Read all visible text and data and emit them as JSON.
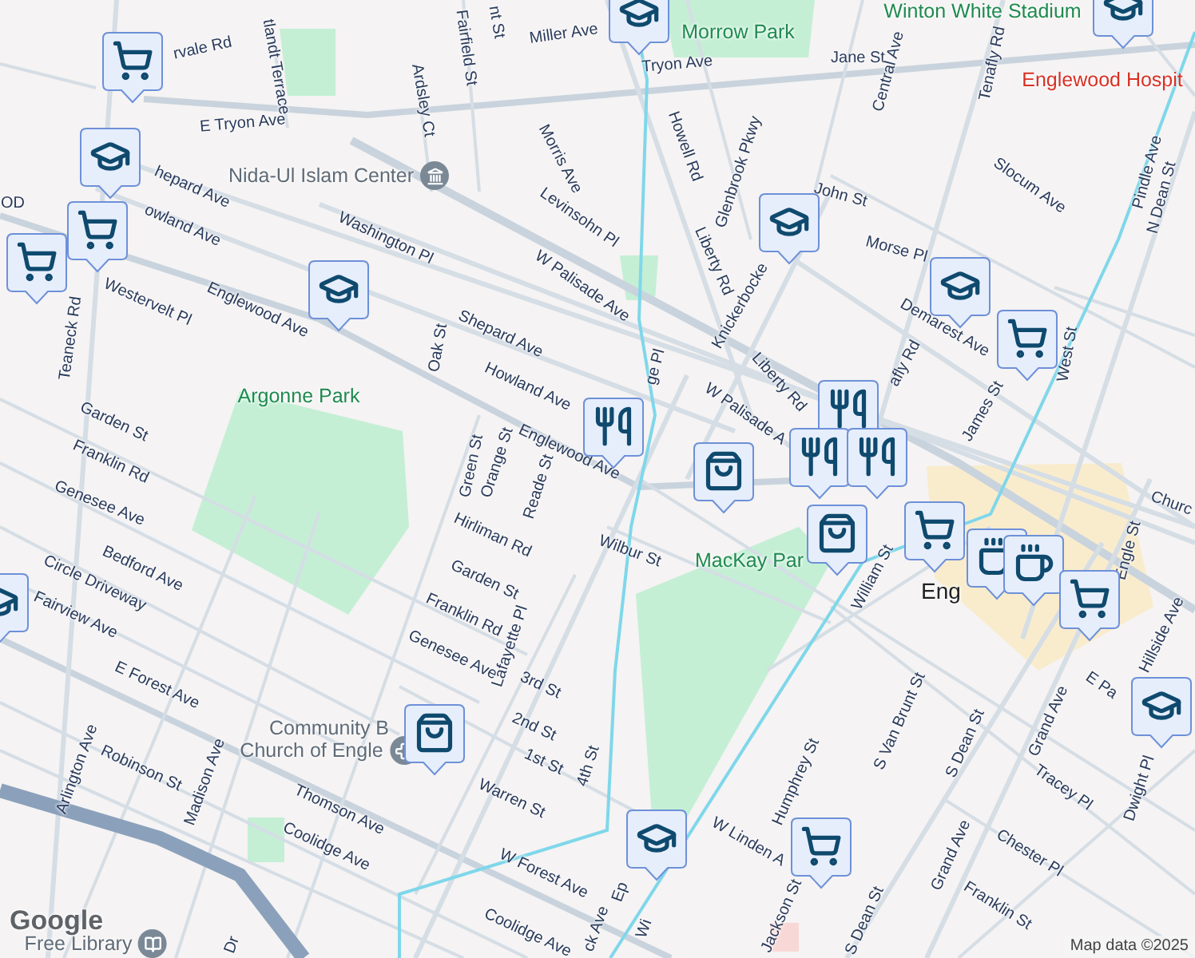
{
  "map": {
    "labels": [
      {
        "text": "nt St",
        "kind": "street"
      },
      {
        "text": "rvale Rd",
        "kind": "street"
      },
      {
        "text": "tlandt Terrace",
        "kind": "street"
      },
      {
        "text": "Fairfield St",
        "kind": "street"
      },
      {
        "text": "Miller Ave",
        "kind": "street"
      },
      {
        "text": "Ardsley Ct",
        "kind": "street"
      },
      {
        "text": "E Tryon Ave",
        "kind": "street"
      },
      {
        "text": "Tryon Ave",
        "kind": "street"
      },
      {
        "text": "Jane St",
        "kind": "street"
      },
      {
        "text": "Central Ave",
        "kind": "street"
      },
      {
        "text": "Tenafly Rd",
        "kind": "street"
      },
      {
        "text": "Howell Rd",
        "kind": "street"
      },
      {
        "text": "Glenbrook Pkwy",
        "kind": "street"
      },
      {
        "text": "Morris Ave",
        "kind": "street"
      },
      {
        "text": "Levinsohn Pl",
        "kind": "street"
      },
      {
        "text": "John St",
        "kind": "street"
      },
      {
        "text": "Slocum Ave",
        "kind": "street"
      },
      {
        "text": "Pindle Ave",
        "kind": "street"
      },
      {
        "text": "N Dean St",
        "kind": "street"
      },
      {
        "text": "Morse Pl",
        "kind": "street"
      },
      {
        "text": "Liberty Rd",
        "kind": "street"
      },
      {
        "text": "Knickerbocke",
        "kind": "street"
      },
      {
        "text": "Demarest Ave",
        "kind": "street"
      },
      {
        "text": "W Palisade Ave",
        "kind": "street"
      },
      {
        "text": "Liberty Rd",
        "kind": "street"
      },
      {
        "text": "afly Rd",
        "kind": "street"
      },
      {
        "text": "West St",
        "kind": "street"
      },
      {
        "text": "James St",
        "kind": "street"
      },
      {
        "text": "W Palisade A",
        "kind": "street"
      },
      {
        "text": "ge Pl",
        "kind": "street"
      },
      {
        "text": "OD",
        "kind": "street"
      },
      {
        "text": "hepard Ave",
        "kind": "street"
      },
      {
        "text": "owland Ave",
        "kind": "street"
      },
      {
        "text": "Washington Pl",
        "kind": "street"
      },
      {
        "text": "Westervelt Pl",
        "kind": "street"
      },
      {
        "text": "Englewood Ave",
        "kind": "street"
      },
      {
        "text": "Teaneck Rd",
        "kind": "street"
      },
      {
        "text": "Oak St",
        "kind": "street"
      },
      {
        "text": "Shepard Ave",
        "kind": "street"
      },
      {
        "text": "Howland Ave",
        "kind": "street"
      },
      {
        "text": "Englewood Ave",
        "kind": "street"
      },
      {
        "text": "Garden St",
        "kind": "street"
      },
      {
        "text": "Franklin Rd",
        "kind": "street"
      },
      {
        "text": "Genesee Ave",
        "kind": "street"
      },
      {
        "text": "Bedford Ave",
        "kind": "street"
      },
      {
        "text": "Circle Driveway",
        "kind": "street"
      },
      {
        "text": "Fairview Ave",
        "kind": "street"
      },
      {
        "text": "E Forest Ave",
        "kind": "street"
      },
      {
        "text": "Arlington Ave",
        "kind": "street"
      },
      {
        "text": "Robinson St",
        "kind": "street"
      },
      {
        "text": "Madison Ave",
        "kind": "street"
      },
      {
        "text": "Thomson Ave",
        "kind": "street"
      },
      {
        "text": "Coolidge Ave",
        "kind": "street"
      },
      {
        "text": "Green St",
        "kind": "street"
      },
      {
        "text": "Orange St",
        "kind": "street"
      },
      {
        "text": "Reade St",
        "kind": "street"
      },
      {
        "text": "Hirliman Rd",
        "kind": "street"
      },
      {
        "text": "Garden St",
        "kind": "street"
      },
      {
        "text": "Franklin Rd",
        "kind": "street"
      },
      {
        "text": "Genesee Ave",
        "kind": "street"
      },
      {
        "text": "Lafayette Pl",
        "kind": "street"
      },
      {
        "text": "3rd St",
        "kind": "street"
      },
      {
        "text": "2nd St",
        "kind": "street"
      },
      {
        "text": "1st St",
        "kind": "street"
      },
      {
        "text": "4th St",
        "kind": "street"
      },
      {
        "text": "Warren St",
        "kind": "street"
      },
      {
        "text": "W Forest Ave",
        "kind": "street"
      },
      {
        "text": "Coolidge Ave",
        "kind": "street"
      },
      {
        "text": "Wilbur St",
        "kind": "street"
      },
      {
        "text": "William St",
        "kind": "street"
      },
      {
        "text": "Humphrey St",
        "kind": "street"
      },
      {
        "text": "S Van Brunt St",
        "kind": "street"
      },
      {
        "text": "S Dean St",
        "kind": "street"
      },
      {
        "text": "Grand Ave",
        "kind": "street"
      },
      {
        "text": "Tracey Pl",
        "kind": "street"
      },
      {
        "text": "Dwight Pl",
        "kind": "street"
      },
      {
        "text": "Hillside Ave",
        "kind": "street"
      },
      {
        "text": "Engle St",
        "kind": "street"
      },
      {
        "text": "Churc",
        "kind": "street"
      },
      {
        "text": "E Pa",
        "kind": "street"
      },
      {
        "text": "W Linden A",
        "kind": "street"
      },
      {
        "text": "Chester Pl",
        "kind": "street"
      },
      {
        "text": "Grand Ave",
        "kind": "street"
      },
      {
        "text": "Franklin St",
        "kind": "street"
      },
      {
        "text": "Jackson St",
        "kind": "street"
      },
      {
        "text": "S Dean St",
        "kind": "street"
      },
      {
        "text": "Ep",
        "kind": "street"
      },
      {
        "text": "Wi",
        "kind": "street"
      },
      {
        "text": "ck Ave",
        "kind": "street"
      },
      {
        "text": "Dr",
        "kind": "street"
      },
      {
        "text": "Winton White Stadium",
        "kind": "park"
      },
      {
        "text": "Morrow Park",
        "kind": "park"
      },
      {
        "text": "Argonne Park",
        "kind": "park"
      },
      {
        "text": "MacKay Par",
        "kind": "park"
      },
      {
        "text": "Englewood Hospit",
        "kind": "hospital"
      },
      {
        "text": "Nida-Ul Islam Center",
        "kind": "landmark"
      },
      {
        "text": "Community B",
        "kind": "landmark"
      },
      {
        "text": "Church of Engle",
        "kind": "landmark"
      },
      {
        "text": "Free Library",
        "kind": "landmark"
      },
      {
        "text": "Eng",
        "kind": "town"
      }
    ],
    "markers": [
      {
        "kind": "school"
      },
      {
        "kind": "school"
      },
      {
        "kind": "cart"
      },
      {
        "kind": "school"
      },
      {
        "kind": "cart"
      },
      {
        "kind": "cart"
      },
      {
        "kind": "school"
      },
      {
        "kind": "school"
      },
      {
        "kind": "school"
      },
      {
        "kind": "cart"
      },
      {
        "kind": "food"
      },
      {
        "kind": "bag"
      },
      {
        "kind": "food"
      },
      {
        "kind": "food"
      },
      {
        "kind": "food"
      },
      {
        "kind": "bag"
      },
      {
        "kind": "cart"
      },
      {
        "kind": "coffee"
      },
      {
        "kind": "coffee"
      },
      {
        "kind": "cart"
      },
      {
        "kind": "school"
      },
      {
        "kind": "school"
      },
      {
        "kind": "bag"
      },
      {
        "kind": "school"
      },
      {
        "kind": "cart"
      }
    ],
    "logo": "Google",
    "attribution": "Map data ©2025"
  }
}
